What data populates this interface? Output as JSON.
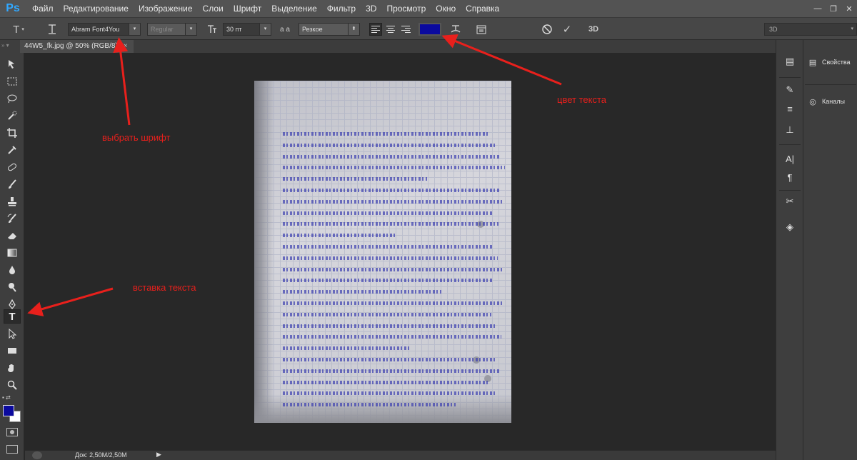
{
  "app": {
    "logo": "Ps",
    "accent": "#31a8ff"
  },
  "menu": [
    "Файл",
    "Редактирование",
    "Изображение",
    "Слои",
    "Шрифт",
    "Выделение",
    "Фильтр",
    "3D",
    "Просмотр",
    "Окно",
    "Справка"
  ],
  "window_controls": [
    "—",
    "❐",
    "✕"
  ],
  "options": {
    "tool_glyph": "T",
    "font_family": "Abram Font4You",
    "font_style": "Regular",
    "font_size": "30 пт",
    "aa_label": "a a",
    "antialias": "Резкое",
    "text_color": "#0b0a9e",
    "three_d": "3D",
    "workspace": "3D"
  },
  "document": {
    "tab_title": "44W5_fk.jpg @ 50% (RGB/8)",
    "tab_close": "×",
    "status": "Док: 2,50M/2,50M"
  },
  "tools": [
    "move-icon",
    "marquee-icon",
    "lasso-icon",
    "quick-select-icon",
    "crop-icon",
    "eyedropper-icon",
    "healing-icon",
    "brush-icon",
    "stamp-icon",
    "history-brush-icon",
    "eraser-icon",
    "gradient-icon",
    "blur-icon",
    "dodge-icon",
    "pen-icon",
    "type-icon",
    "path-select-icon",
    "shape-icon",
    "hand-icon",
    "zoom-icon"
  ],
  "colors": {
    "foreground": "#0b0a9e",
    "background": "#ffffff"
  },
  "panels": {
    "properties": "Свойства",
    "channels": "Каналы"
  },
  "annotations": {
    "font": "выбрать шрифт",
    "color": "цвет текста",
    "insert": "вставка текста",
    "color_hex": "#e8201c"
  }
}
